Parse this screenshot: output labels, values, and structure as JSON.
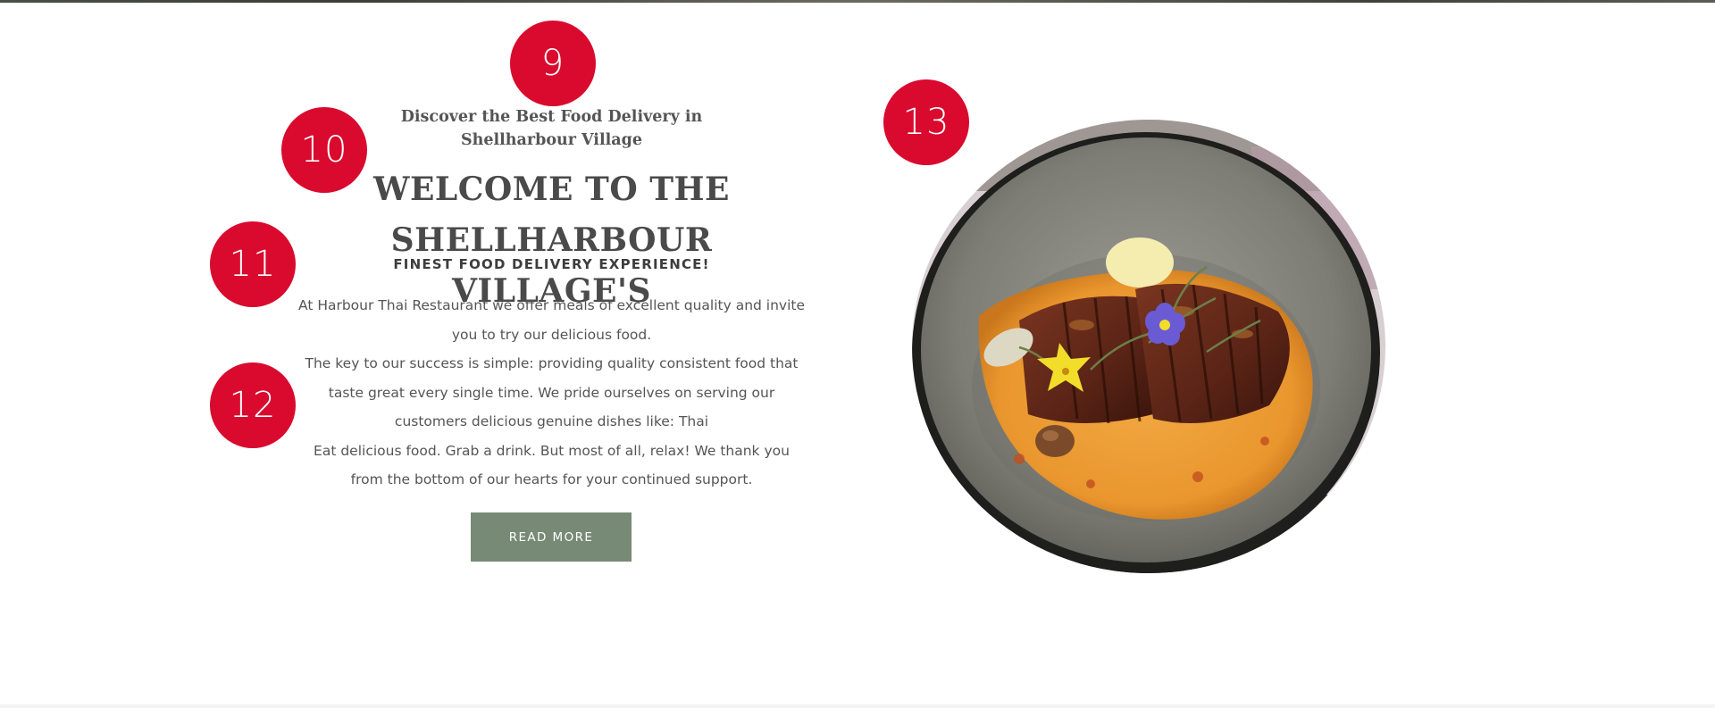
{
  "badges": [
    "9",
    "10",
    "11",
    "12",
    "13"
  ],
  "intro": {
    "eyebrow_line1": "Discover the Best Food Delivery in",
    "eyebrow_line2": "Shellharbour Village",
    "headline_line1": "WELCOME TO THE",
    "headline_line2": "SHELLHARBOUR VILLAGE'S",
    "subhead": "FINEST FOOD DELIVERY EXPERIENCE!",
    "paragraphs": [
      [
        "At Harbour Thai Restaurant we offer meals of excellent quality and invite",
        "you to try our delicious food."
      ],
      [
        "The key to our success is simple: providing quality consistent food that",
        "taste great every single time. We pride ourselves on serving our",
        "customers delicious genuine dishes like: Thai"
      ],
      [
        "Eat delicious food. Grab a drink. But most of all, relax! We thank you",
        "from the bottom of our hearts for your continued support."
      ]
    ],
    "button_label": "READ MORE"
  },
  "image": {
    "subject": "duck-curry-bowl",
    "colors": {
      "bowl": "#7d7d76",
      "rim": "#1e1e1c",
      "curry": "#e9962e",
      "duck": "#5a2416",
      "flower_purple": "#6a5bd4",
      "flower_yellow": "#f2dd2b"
    }
  },
  "colors": {
    "badge": "#d90a2e",
    "button": "#778a76",
    "text": "#4a4a4a"
  }
}
